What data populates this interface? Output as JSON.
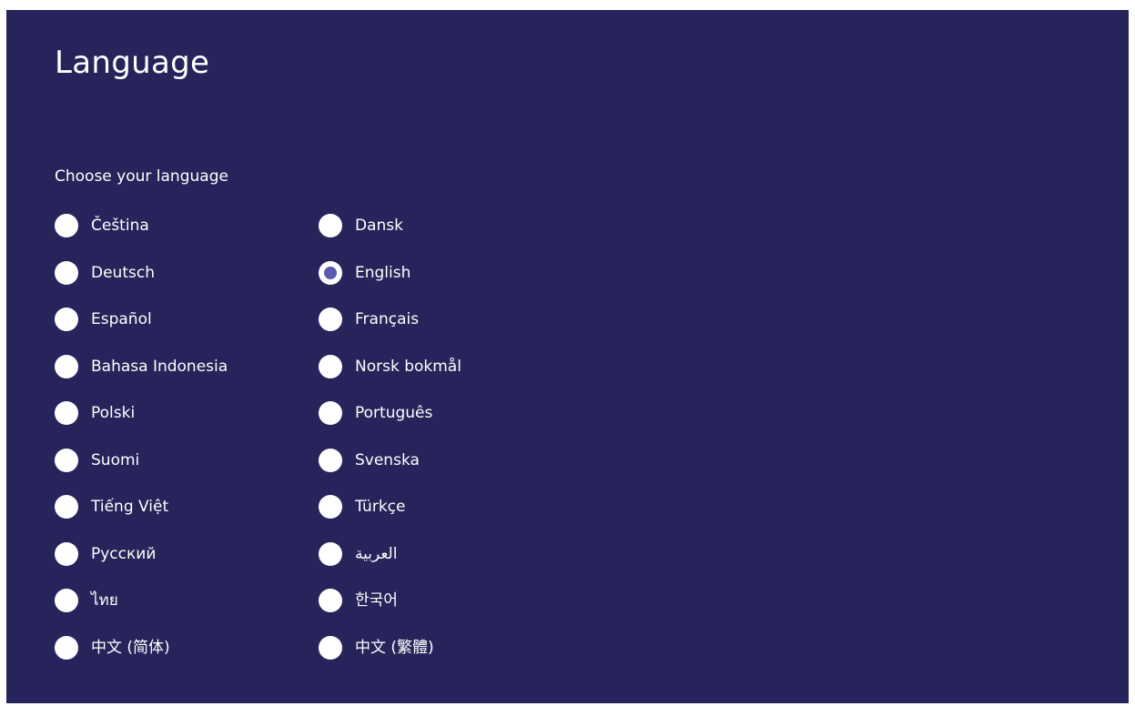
{
  "header": {
    "title": "Language",
    "subtitle": "Choose your language"
  },
  "colors": {
    "background": "#26245a",
    "radio_fill": "#ffffff",
    "radio_selected_dot": "#5a5bb0"
  },
  "languages": [
    {
      "label": "Čeština",
      "selected": false
    },
    {
      "label": "Dansk",
      "selected": false
    },
    {
      "label": "Deutsch",
      "selected": false
    },
    {
      "label": "English",
      "selected": true
    },
    {
      "label": "Español",
      "selected": false
    },
    {
      "label": "Français",
      "selected": false
    },
    {
      "label": "Bahasa Indonesia",
      "selected": false
    },
    {
      "label": "Norsk bokmål",
      "selected": false
    },
    {
      "label": "Polski",
      "selected": false
    },
    {
      "label": "Português",
      "selected": false
    },
    {
      "label": "Suomi",
      "selected": false
    },
    {
      "label": "Svenska",
      "selected": false
    },
    {
      "label": "Tiếng Việt",
      "selected": false
    },
    {
      "label": "Türkçe",
      "selected": false
    },
    {
      "label": "Русский",
      "selected": false
    },
    {
      "label": "العربية",
      "selected": false
    },
    {
      "label": "ไทย",
      "selected": false
    },
    {
      "label": "한국어",
      "selected": false
    },
    {
      "label": "中文 (简体)",
      "selected": false
    },
    {
      "label": "中文 (繁體)",
      "selected": false
    }
  ]
}
